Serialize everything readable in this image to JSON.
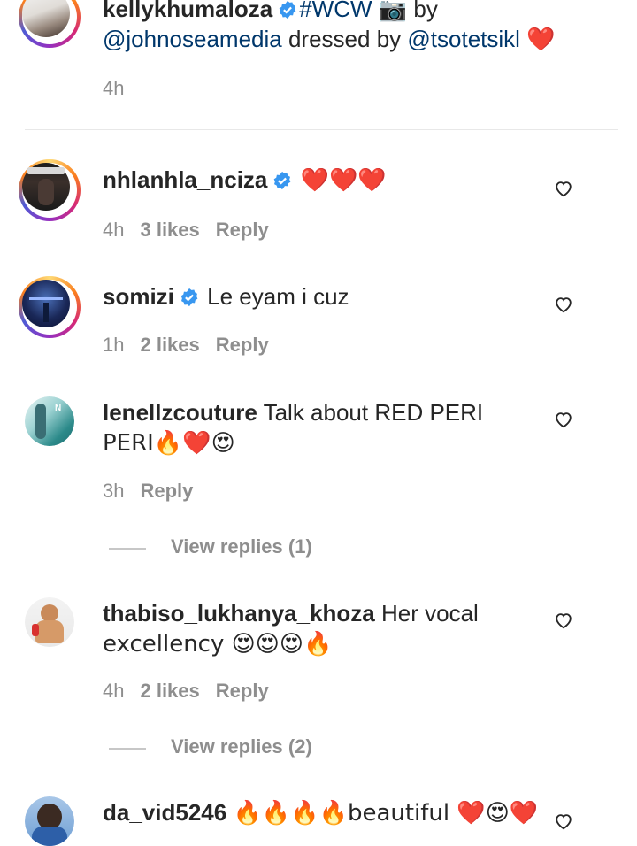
{
  "caption": {
    "username": "kellykhumaloza",
    "text_hashtag": "#WCW",
    "camera_emoji": "📷",
    "text_by": " by",
    "mention1": "@johnoseamedia",
    "text_dressed": " dressed by ",
    "mention2": "@tsotetsikl",
    "heart": "❤️",
    "time": "4h"
  },
  "comments": [
    {
      "username": "nhlanhla_nciza",
      "verified": true,
      "text": "❤️❤️❤️",
      "time": "4h",
      "likes": "3 likes",
      "reply": "Reply"
    },
    {
      "username": "somizi",
      "verified": true,
      "text": "Le eyam i cuz",
      "time": "1h",
      "likes": "2 likes",
      "reply": "Reply"
    },
    {
      "username": "lenellzcouture",
      "text_line1": "Talk about RED PERI",
      "text_line2": "PERI🔥❤️😍",
      "time": "3h",
      "reply": "Reply",
      "view_replies": "View replies (1)"
    },
    {
      "username": "thabiso_lukhanya_khoza",
      "text_line1": "Her vocal",
      "text_line2": "excellency 😍😍😍🔥",
      "time": "4h",
      "likes": "2 likes",
      "reply": "Reply",
      "view_replies": "View replies (2)"
    },
    {
      "username": "da_vid5246",
      "text": "🔥🔥🔥🔥beautiful ❤️😍❤️"
    }
  ],
  "colors": {
    "verified_blue": "#3897f0",
    "mention": "#00376b",
    "meta_gray": "#8e8e8e"
  },
  "icons": {
    "like": "heart-outline-icon",
    "verified": "verified-badge-icon"
  }
}
